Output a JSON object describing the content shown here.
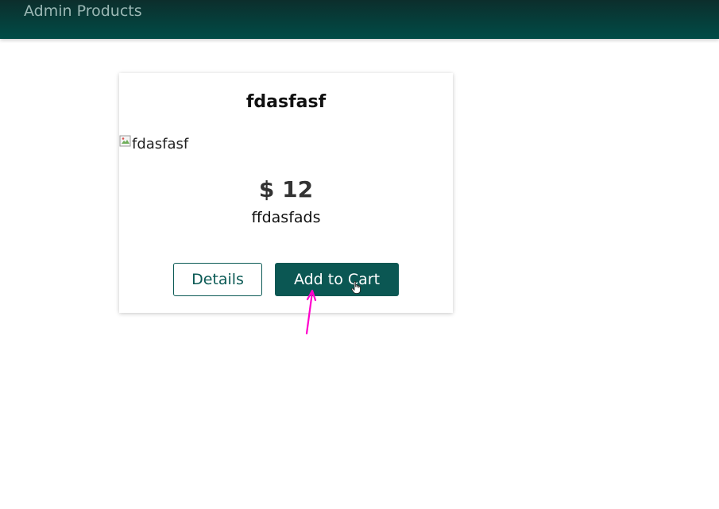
{
  "nav": {
    "admin_products": "Admin Products"
  },
  "product": {
    "title": "fdasfasf",
    "image_alt": "fdasfasf",
    "price": "$ 12",
    "description": "ffdasfads",
    "details_label": "Details",
    "add_to_cart_label": "Add to Cart"
  },
  "colors": {
    "header": "#004c47",
    "accent": "#0b5753",
    "annotation": "#ff00cc"
  },
  "icons": {
    "broken_image": "broken-image-icon",
    "cursor": "hand-cursor-icon",
    "annotation": "annotation-arrow-icon"
  }
}
